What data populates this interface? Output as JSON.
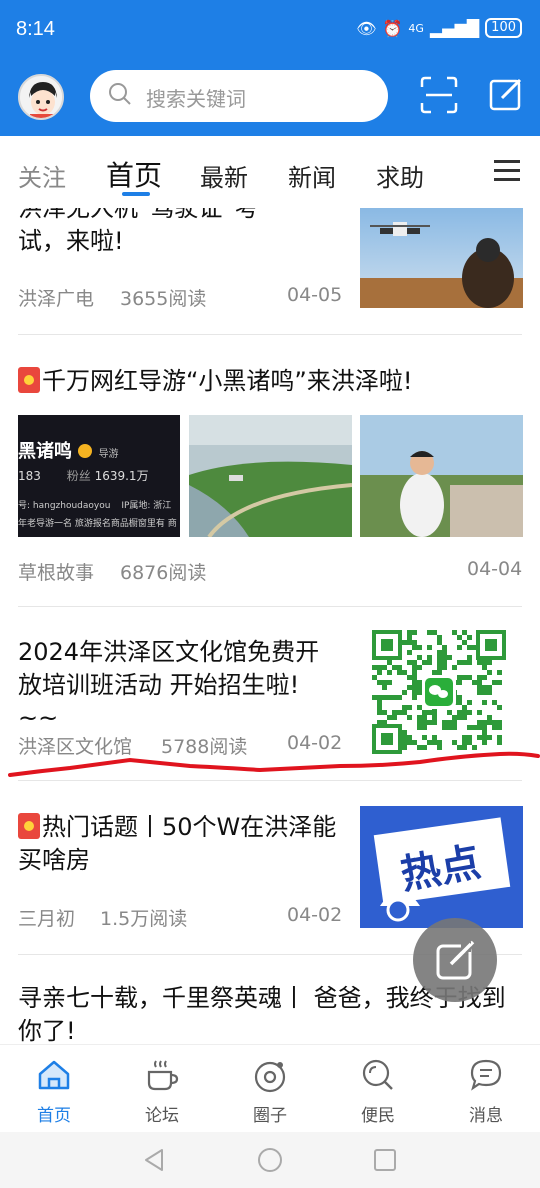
{
  "status": {
    "time": "8:14",
    "signal": "4G",
    "battery": "100"
  },
  "search": {
    "placeholder": "搜索关键词"
  },
  "tabs": [
    {
      "label": "关注"
    },
    {
      "label": "首页"
    },
    {
      "label": "最新"
    },
    {
      "label": "新闻"
    },
    {
      "label": "求助"
    }
  ],
  "feed": {
    "item1": {
      "title_partial": "洪泽无人机“驾驶证”考",
      "title_line2": "试，来啦!",
      "source": "洪泽广电",
      "reads": "3655阅读",
      "date": "04-05"
    },
    "item2": {
      "title": "千万网红导游“小黑诸鸣”来洪泽啦!",
      "source": "草根故事",
      "reads": "6876阅读",
      "date": "04-04",
      "profile_name": "黑诸鸣",
      "profile_badge": "导游",
      "profile_stat1": "183",
      "profile_followers_label": "粉丝",
      "profile_followers": "1639.1万",
      "profile_id": "号: hangzhoudaoyou",
      "profile_ip": "IP属地: 浙江",
      "profile_desc": "年老导游一名 旅游报名商品橱窗里有 商"
    },
    "item3": {
      "title": "2024年洪泽区文化馆免费开放培训班活动 开始招生啦! ~~",
      "source": "洪泽区文化馆",
      "reads": "5788阅读",
      "date": "04-02"
    },
    "item4": {
      "title": "热门话题丨50个W在洪泽能买啥房",
      "source": "三月初",
      "reads": "1.5万阅读",
      "date": "04-02",
      "thumb_text": "热点"
    },
    "item5": {
      "title": "寻亲七十载，千里祭英魂丨 爸爸，我终于找到你了!"
    }
  },
  "bottom_nav": [
    {
      "label": "首页",
      "icon": "home-icon"
    },
    {
      "label": "论坛",
      "icon": "coffee-icon"
    },
    {
      "label": "圈子",
      "icon": "circle-icon"
    },
    {
      "label": "便民",
      "icon": "search-icon"
    },
    {
      "label": "消息",
      "icon": "message-icon"
    }
  ],
  "colors": {
    "primary": "#1e7fe6",
    "badge": "#e9473d",
    "annotation": "#e0141e"
  }
}
